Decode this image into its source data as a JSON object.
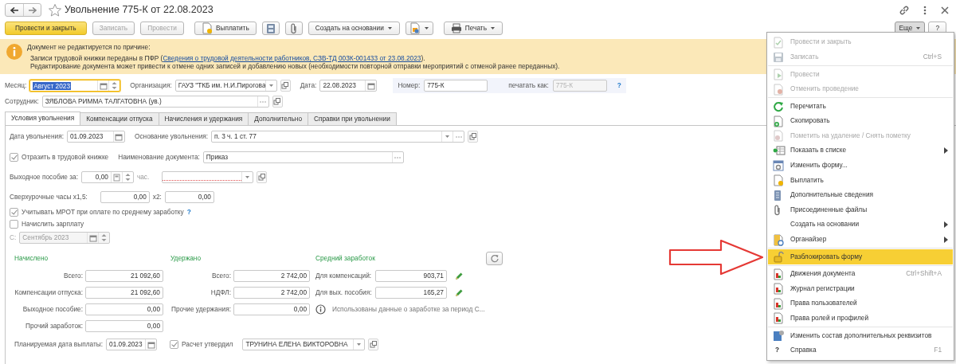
{
  "window": {
    "title": "Увольнение 775-К от 22.08.2023",
    "favorite": false
  },
  "toolbar": [
    {
      "kind": "primary",
      "label": "Провести и закрыть",
      "disabled": false
    },
    {
      "kind": "text",
      "label": "Записать",
      "disabled": true
    },
    {
      "kind": "text",
      "label": "Провести",
      "disabled": true
    },
    {
      "kind": "icon-text",
      "label": "Выплатить",
      "disabled": false
    },
    {
      "kind": "icon",
      "disabled": false
    },
    {
      "kind": "icon",
      "disabled": false
    },
    {
      "kind": "menu",
      "label": "Создать на основании",
      "disabled": false
    },
    {
      "kind": "icon-menu",
      "disabled": false
    },
    {
      "kind": "icon-text-menu",
      "label": "Печать",
      "disabled": false
    }
  ],
  "more_button": {
    "label": "Еще",
    "expanded": true
  },
  "help_button": {
    "label": "?"
  },
  "notice": {
    "title": "Документ не редактируется по причине:",
    "reason": {
      "text": "Записи трудовой книжки переданы в ПФР (",
      "link": "Сведения о трудовой деятельности работников, СЗВ-ТД 003К-001433 от 23.08.2023",
      "tail": ")."
    },
    "note": "Редактирование документа может привести к отмене одних записей и добавлению новых (необходимости повторной отправки мероприятий с отменой ранее переданных)."
  },
  "header": {
    "month": {
      "label": "Месяц:",
      "value": "Август 2023",
      "focused": true
    },
    "organization": {
      "label": "Организация:",
      "value": "ГАУЗ \"ТКБ им. Н.И.Пирогова"
    },
    "date": {
      "label": "Дата:",
      "value": "22.08.2023"
    },
    "number": {
      "label": "Номер:",
      "value": "775-К"
    },
    "print_as": {
      "label": "печатать как:",
      "placeholder": "775-К",
      "help": "?"
    },
    "employee": {
      "label": "Сотрудник:",
      "value": "ЗЯБЛОВА РИММА ТАЛГАТОВНА (ув.)"
    }
  },
  "tabs": [
    {
      "label": "Условия увольнения",
      "selected": true
    },
    {
      "label": "Компенсации отпуска",
      "selected": false
    },
    {
      "label": "Начисления и удержания",
      "selected": false
    },
    {
      "label": "Дополнительно",
      "selected": false
    },
    {
      "label": "Справки при увольнении",
      "selected": false
    }
  ],
  "conditions": {
    "dismissal_date": {
      "label": "Дата увольнения:",
      "value": "01.09.2023"
    },
    "dismissal_basis": {
      "label": "Основание увольнения:",
      "value": "п. 3 ч. 1 ст. 77"
    },
    "record_in_workbook": {
      "label": "Отразить в трудовой книжке",
      "checked": true
    },
    "document_name": {
      "label": "Наименование документа:",
      "value": "Приказ"
    },
    "severance": {
      "label": "Выходное пособие за:",
      "value": "0,00",
      "unit": "час.",
      "required": true
    },
    "overtime": {
      "label": "Сверхурочные часы х1,5:",
      "value": "0,00",
      "label2": "х2:",
      "value2": "0,00"
    },
    "mrot": {
      "label": "Учитывать МРОТ при оплате по среднему заработку",
      "checked": true,
      "help": "?"
    },
    "accrue_salary": {
      "label": "Начислить зарплату",
      "checked": false
    },
    "from": {
      "label": "С:",
      "value": "Сентябрь 2023",
      "disabled": true
    }
  },
  "totals": {
    "accrued": {
      "title": "Начислено",
      "rows": [
        {
          "label": "Всего:",
          "value": "21 092,60"
        },
        {
          "label": "Компенсации отпуска:",
          "value": "21 092,60"
        },
        {
          "label": "Выходное пособие:",
          "value": "0,00"
        },
        {
          "label": "Прочий заработок:",
          "value": "0,00"
        }
      ]
    },
    "withheld": {
      "title": "Удержано",
      "rows": [
        {
          "label": "Всего:",
          "value": "2 742,00"
        },
        {
          "label": "НДФЛ:",
          "value": "2 742,00"
        },
        {
          "label": "Прочие удержания:",
          "value": "0,00"
        }
      ]
    },
    "average": {
      "title": "Средний заработок",
      "rows": [
        {
          "label": "Для компенсаций:",
          "value": "903,71"
        },
        {
          "label": "Для вых. пособия:",
          "value": "165,27"
        }
      ],
      "note": "Использованы данные о заработке за период С..."
    }
  },
  "payment": {
    "label": "Планируемая дата выплаты:",
    "value": "01.09.2023",
    "approved": {
      "label": "Расчет утвердил",
      "checked": true
    },
    "approver": "ТРУНИНА ЕЛЕНА ВИКТОРОВНА"
  },
  "menu": [
    {
      "kind": "item",
      "label": "Провести и закрыть",
      "disabled": true,
      "selected": false,
      "submenu": false
    },
    {
      "kind": "item",
      "label": "Записать",
      "shortcut": "Ctrl+S",
      "disabled": true,
      "selected": false,
      "submenu": false
    },
    {
      "kind": "separator"
    },
    {
      "kind": "item",
      "label": "Провести",
      "disabled": true,
      "selected": false,
      "submenu": false
    },
    {
      "kind": "item",
      "label": "Отменить проведение",
      "disabled": true,
      "selected": false,
      "submenu": false
    },
    {
      "kind": "separator"
    },
    {
      "kind": "item",
      "label": "Перечитать",
      "disabled": false,
      "selected": false,
      "submenu": false
    },
    {
      "kind": "item",
      "label": "Скопировать",
      "disabled": false,
      "selected": false,
      "submenu": false
    },
    {
      "kind": "item",
      "label": "Пометить на удаление / Снять пометку",
      "disabled": true,
      "selected": false,
      "submenu": false
    },
    {
      "kind": "item",
      "label": "Показать в списке",
      "disabled": false,
      "selected": false,
      "submenu": true
    },
    {
      "kind": "item",
      "label": "Изменить форму...",
      "disabled": false,
      "selected": false,
      "submenu": false
    },
    {
      "kind": "item",
      "label": "Выплатить",
      "disabled": false,
      "selected": false,
      "submenu": false
    },
    {
      "kind": "item",
      "label": "Дополнительные сведения",
      "disabled": false,
      "selected": false,
      "submenu": false
    },
    {
      "kind": "item",
      "label": "Присоединенные файлы",
      "disabled": false,
      "selected": false,
      "submenu": false
    },
    {
      "kind": "item",
      "label": "Создать на основании",
      "disabled": false,
      "selected": false,
      "submenu": true
    },
    {
      "kind": "item",
      "label": "Органайзер",
      "disabled": false,
      "selected": false,
      "submenu": true
    },
    {
      "kind": "separator"
    },
    {
      "kind": "item",
      "label": "Разблокировать форму",
      "disabled": false,
      "selected": true,
      "submenu": false
    },
    {
      "kind": "separator"
    },
    {
      "kind": "item",
      "label": "Движения документа",
      "shortcut": "Ctrl+Shift+A",
      "disabled": false,
      "selected": false,
      "submenu": false
    },
    {
      "kind": "item",
      "label": "Журнал регистрации",
      "disabled": false,
      "selected": false,
      "submenu": false
    },
    {
      "kind": "item",
      "label": "Права пользователей",
      "disabled": false,
      "selected": false,
      "submenu": false
    },
    {
      "kind": "item",
      "label": "Права ролей и профилей",
      "disabled": false,
      "selected": false,
      "submenu": false
    },
    {
      "kind": "separator"
    },
    {
      "kind": "item",
      "label": "Изменить состав дополнительных реквизитов",
      "disabled": false,
      "selected": false,
      "submenu": false
    },
    {
      "kind": "item",
      "label": "Справка",
      "glyph": "?",
      "shortcut": "F1",
      "disabled": false,
      "selected": false,
      "submenu": false
    }
  ]
}
